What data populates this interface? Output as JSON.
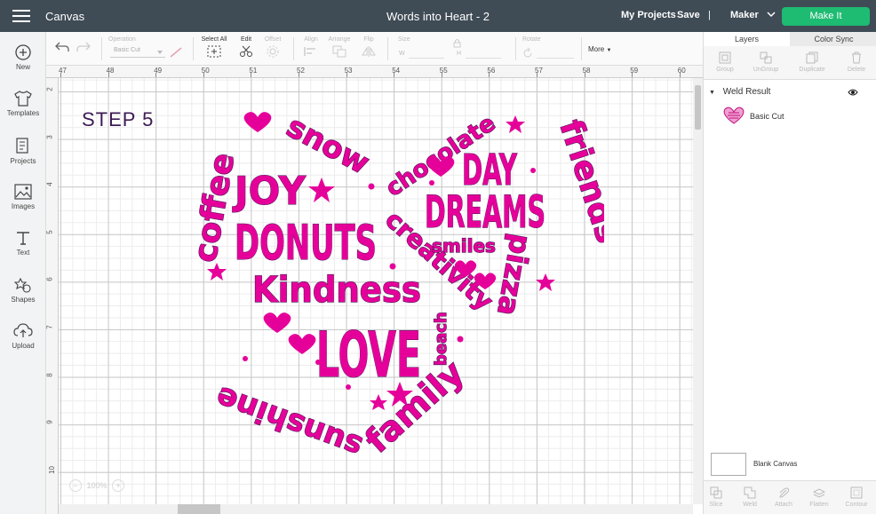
{
  "app": {
    "name": "Canvas",
    "document_title": "Words into Heart - 2"
  },
  "topbar": {
    "my_projects": "My Projects",
    "save": "Save",
    "separator": "|",
    "machine": "Maker",
    "make_it": "Make It"
  },
  "sidebar": {
    "items": [
      {
        "label": "New",
        "icon": "plus-circle-icon"
      },
      {
        "label": "Templates",
        "icon": "shirt-icon"
      },
      {
        "label": "Projects",
        "icon": "projects-icon"
      },
      {
        "label": "Images",
        "icon": "image-icon"
      },
      {
        "label": "Text",
        "icon": "text-icon"
      },
      {
        "label": "Shapes",
        "icon": "shapes-icon"
      },
      {
        "label": "Upload",
        "icon": "upload-icon"
      }
    ]
  },
  "toolbar": {
    "operation_label": "Operation",
    "operation_value": "Basic Cut",
    "select_all": "Select All",
    "edit": "Edit",
    "offset": "Offset",
    "align": "Align",
    "arrange": "Arrange",
    "flip": "Flip",
    "size": "Size",
    "w": "W",
    "h": "H",
    "rotate": "Rotate",
    "more": "More"
  },
  "rulers": {
    "top": [
      "47",
      "48",
      "49",
      "50",
      "51",
      "52",
      "53",
      "54",
      "55",
      "56",
      "57",
      "58",
      "59",
      "60"
    ],
    "left": [
      "2",
      "3",
      "4",
      "5",
      "6",
      "7",
      "8",
      "9",
      "10"
    ]
  },
  "canvas": {
    "step_label": "STEP 5",
    "zoom_value": "100%",
    "words": [
      "coffee",
      "snow",
      "JOY",
      "DONUTS",
      "Kindness",
      "sunshine",
      "LOVE",
      "family",
      "chocolate",
      "DAY",
      "DREAMS",
      "creativity",
      "smiles",
      "beach",
      "pizza",
      "friends"
    ],
    "art_color": "#e6009a",
    "art_outline": "#4b1556"
  },
  "panel": {
    "tabs": [
      "Layers",
      "Color Sync"
    ],
    "tools": [
      "Group",
      "UnGroup",
      "Duplicate",
      "Delete"
    ],
    "layer_group": "Weld Result",
    "layer_child": "Basic Cut",
    "blank_canvas": "Blank Canvas",
    "bottom_tools": [
      "Slice",
      "Weld",
      "Attach",
      "Flatten",
      "Contour"
    ]
  }
}
